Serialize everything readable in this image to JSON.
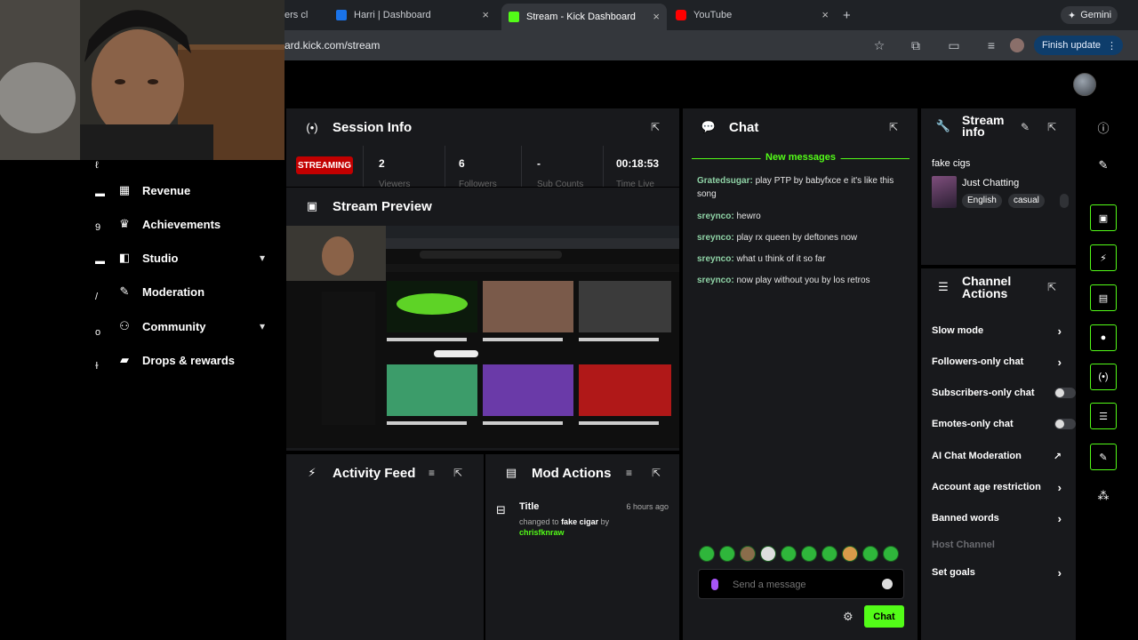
{
  "browser": {
    "tabs": [
      {
        "label": "ers cl",
        "favicon_color": "#000000"
      },
      {
        "label": "Harri | Dashboard",
        "favicon_color": "#1a73e8"
      },
      {
        "label": "Stream - Kick Dashboard",
        "favicon_color": "#53fc18"
      },
      {
        "label": "YouTube",
        "favicon_color": "#ff0000"
      }
    ],
    "url": "ard.kick.com/stream",
    "finish_update": "Finish update",
    "gemini": "Gemini",
    "new_tab": "+",
    "close_glyph": "×"
  },
  "nav": {
    "items": [
      {
        "label": "Revenue",
        "icon": "revenue-icon",
        "glyph": "▦"
      },
      {
        "label": "Achievements",
        "icon": "trophy-icon",
        "glyph": "🏆"
      },
      {
        "label": "Studio",
        "icon": "studio-icon",
        "glyph": "◧"
      },
      {
        "label": "Moderation",
        "icon": "wrench-icon",
        "glyph": "🔧"
      },
      {
        "label": "Community",
        "icon": "community-icon",
        "glyph": "◉"
      },
      {
        "label": "Drops & rewards",
        "icon": "drops-icon",
        "glyph": "▰"
      }
    ],
    "chevron": "⌄"
  },
  "session": {
    "title": "Session Info",
    "badge": "STREAMING",
    "stats": [
      {
        "value": "2",
        "label": "Viewers"
      },
      {
        "value": "6",
        "label": "Followers"
      },
      {
        "value": "-",
        "label": "Sub Counts"
      },
      {
        "value": "00:18:53",
        "label": "Time Live"
      }
    ]
  },
  "preview": {
    "title": "Stream Preview"
  },
  "activity": {
    "title": "Activity Feed"
  },
  "mod_actions": {
    "title": "Mod Actions",
    "entry": {
      "title": "Title",
      "time": "6 hours ago",
      "changed_to": "changed to",
      "value": "fake cigar",
      "by": "by",
      "user": "chrisfknraw"
    }
  },
  "chat": {
    "title": "Chat",
    "new_messages": "New messages",
    "messages": [
      {
        "user": "Gratedsugar:",
        "text": "play PTP by babyfxce e it's like this song"
      },
      {
        "user": "sreynco:",
        "text": "hewro"
      },
      {
        "user": "sreynco:",
        "text": "play rx queen by deftones now"
      },
      {
        "user": "sreynco:",
        "text": "what u think of it so far"
      },
      {
        "user": "sreynco:",
        "text": "now play without you by los retros"
      }
    ],
    "input_placeholder": "Send a message",
    "send_label": "Chat",
    "emote_count": 10
  },
  "stream_info": {
    "title": "Stream info",
    "stream_title": "fake cigs",
    "category": "Just Chatting",
    "tags": [
      "English",
      "casual"
    ]
  },
  "channel_actions": {
    "title": "Channel Actions",
    "items": [
      {
        "label": "Slow mode",
        "control": "chevron"
      },
      {
        "label": "Followers-only chat",
        "control": "chevron"
      },
      {
        "label": "Subscribers-only chat",
        "control": "toggle"
      },
      {
        "label": "Emotes-only chat",
        "control": "toggle"
      },
      {
        "label": "AI Chat Moderation",
        "control": "external"
      },
      {
        "label": "Account age restriction",
        "control": "chevron"
      },
      {
        "label": "Banned words",
        "control": "chevron"
      },
      {
        "label": "Host Channel",
        "control": "none"
      },
      {
        "label": "Set goals",
        "control": "chevron"
      }
    ],
    "chevron": "›"
  },
  "colors": {
    "accent": "#53fc18",
    "streaming_badge": "#c20000",
    "panel_bg": "#18191c",
    "chat_username": "#8fd3a6"
  }
}
